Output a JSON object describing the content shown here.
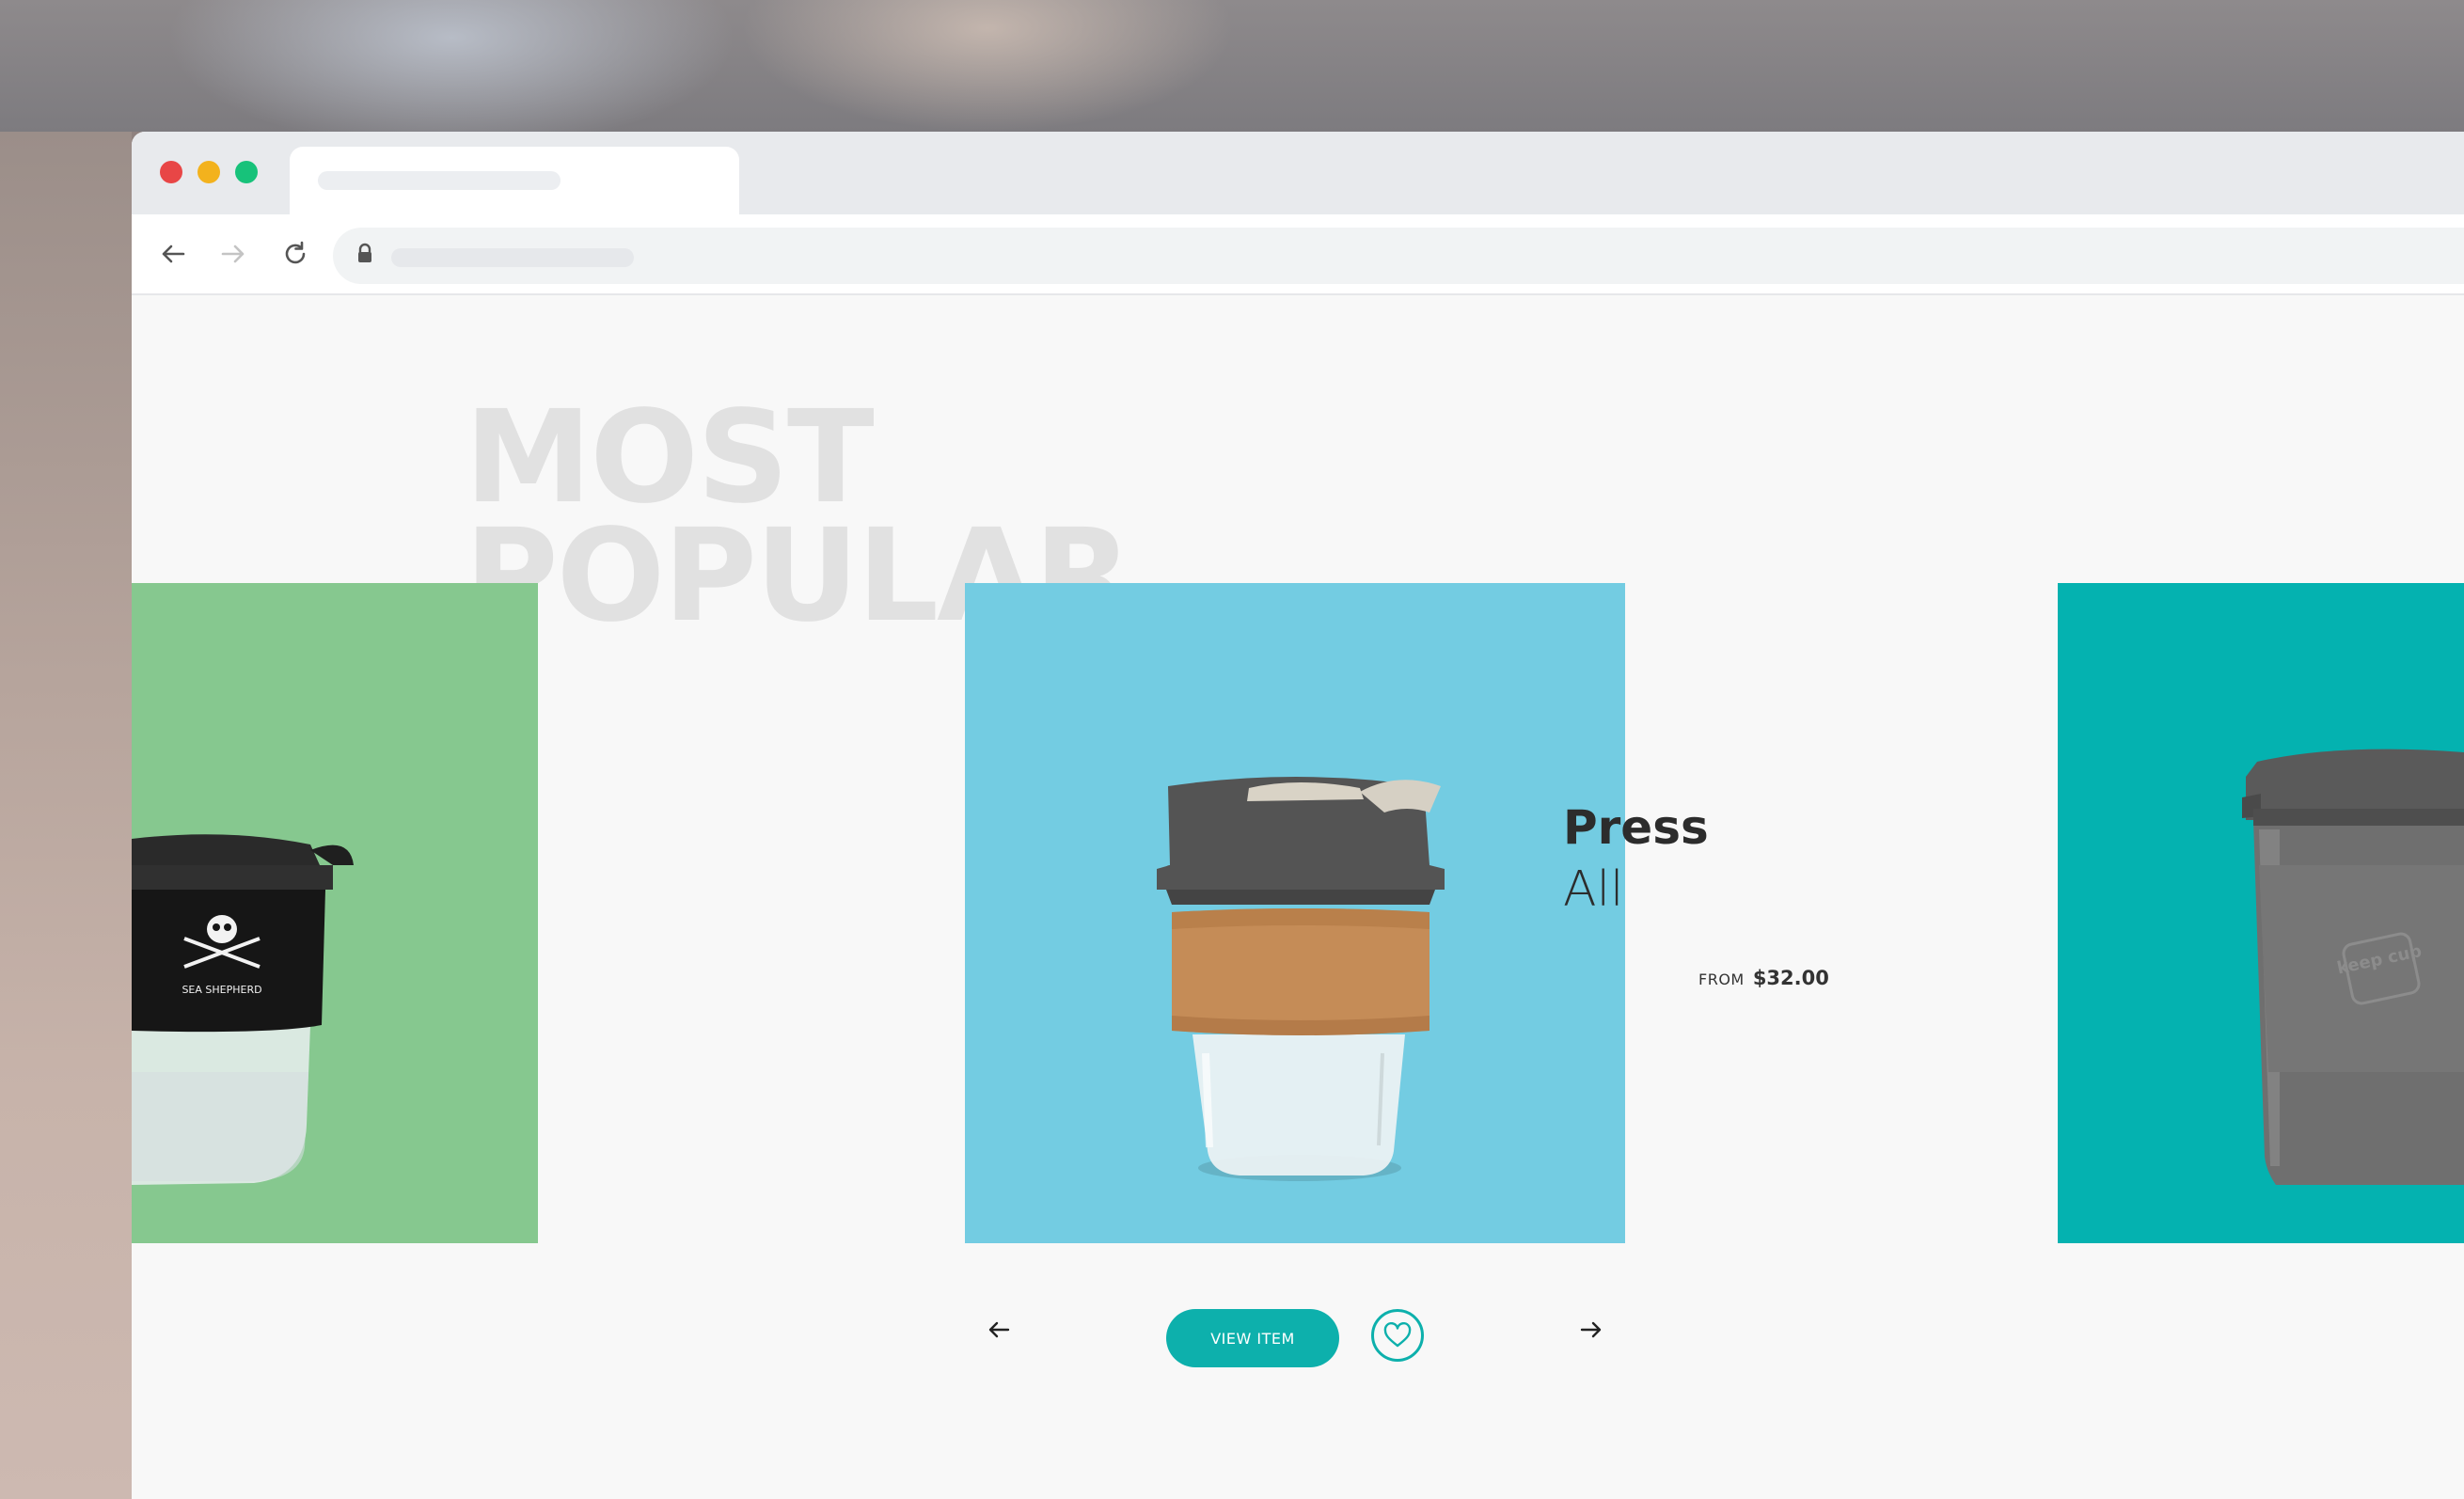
{
  "section": {
    "title_line1": "MOST",
    "title_line2": "POPULAR"
  },
  "products": [
    {
      "position": "previous",
      "color": "#86c88f",
      "print": "SEA SHEPHERD"
    },
    {
      "position": "current",
      "color": "#73cce2",
      "name": "Press",
      "subtitle": "All",
      "price_prefix": "FROM",
      "price": "$32.00"
    },
    {
      "position": "next",
      "color": "#04b2b0",
      "emboss": "keep cup"
    }
  ],
  "controls": {
    "view_item_label": "VIEW ITEM",
    "prev_icon": "arrow-left-icon",
    "next_icon": "arrow-right-icon",
    "favorite_icon": "heart-icon",
    "accent": "#0db0ac"
  },
  "browser": {
    "window_buttons": [
      "close",
      "minimize",
      "maximize"
    ],
    "toolbar_icons": [
      "back-arrow-icon",
      "forward-arrow-icon",
      "reload-icon",
      "lock-icon"
    ]
  }
}
